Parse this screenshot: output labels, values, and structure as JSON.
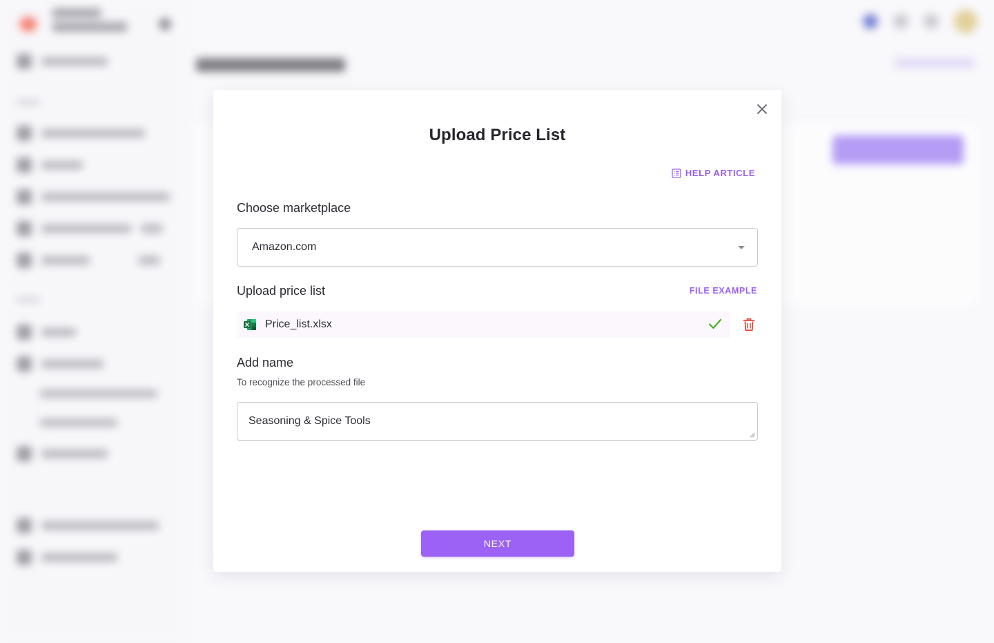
{
  "modal": {
    "title": "Upload Price List",
    "help_article": "HELP ARTICLE",
    "marketplace": {
      "label": "Choose marketplace",
      "selected": "Amazon.com"
    },
    "upload": {
      "label": "Upload price list",
      "file_example": "FILE EXAMPLE",
      "file_name": "Price_list.xlsx"
    },
    "name": {
      "label": "Add name",
      "hint": "To recognize the processed file",
      "value": "Seasoning & Spice Tools"
    },
    "next_label": "NEXT"
  },
  "colors": {
    "accent": "#9b62f5",
    "link": "#9a5ff0",
    "success": "#4caf1f",
    "danger": "#e5483a",
    "excel": "#1d7044"
  },
  "icons": [
    "close-icon",
    "help-article-icon",
    "chevron-down-icon",
    "excel-file-icon",
    "check-icon",
    "trash-icon",
    "resize-grip-icon"
  ]
}
